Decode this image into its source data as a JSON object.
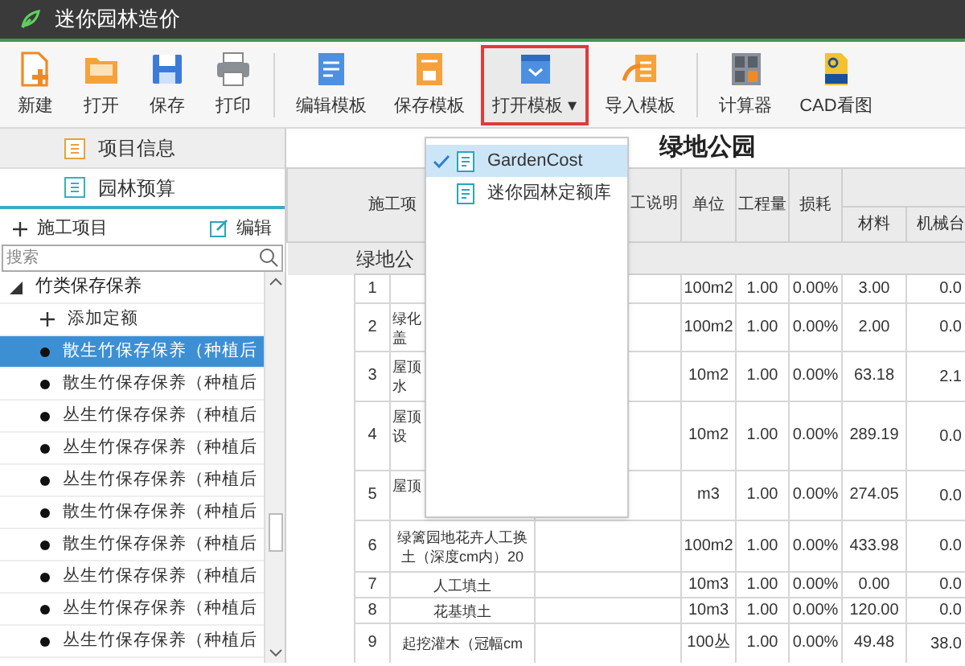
{
  "window": {
    "title": "迷你园林造价"
  },
  "toolbar": [
    {
      "kind": "new",
      "label": "新建",
      "highlighted": false,
      "divider_after": false
    },
    {
      "kind": "open",
      "label": "打开",
      "highlighted": false,
      "divider_after": false
    },
    {
      "kind": "save",
      "label": "保存",
      "highlighted": false,
      "divider_after": false
    },
    {
      "kind": "print",
      "label": "打印",
      "highlighted": false,
      "divider_after": true
    },
    {
      "kind": "edit-template",
      "label": "编辑模板",
      "highlighted": false,
      "divider_after": false
    },
    {
      "kind": "save-template",
      "label": "保存模板",
      "highlighted": false,
      "divider_after": false
    },
    {
      "kind": "open-template",
      "label": "打开模板",
      "caret": "▾",
      "highlighted": true,
      "divider_after": false
    },
    {
      "kind": "import-template",
      "label": "导入模板",
      "highlighted": false,
      "divider_after": true
    },
    {
      "kind": "calculator",
      "label": "计算器",
      "highlighted": false,
      "divider_after": false
    },
    {
      "kind": "cad",
      "label": "CAD看图",
      "highlighted": false,
      "divider_after": false
    }
  ],
  "sidebar": {
    "tabs": [
      {
        "kind": "info",
        "label": "项目信息",
        "selected": false
      },
      {
        "kind": "budget",
        "label": "园林预算",
        "selected": true
      }
    ],
    "add_label": "施工项目",
    "edit_label": "编辑",
    "search": {
      "placeholder": "搜索"
    },
    "tree": [
      {
        "label": "竹类保存保养",
        "expanded": true,
        "children": [
          {
            "kind": "add",
            "label": "添加定额",
            "selected": false
          },
          {
            "kind": "item",
            "label": "散生竹保存保养（种植后",
            "selected": true
          },
          {
            "kind": "item",
            "label": "散生竹保存保养（种植后",
            "selected": false
          },
          {
            "kind": "item",
            "label": "丛生竹保存保养（种植后",
            "selected": false
          },
          {
            "kind": "item",
            "label": "丛生竹保存保养（种植后",
            "selected": false
          },
          {
            "kind": "item",
            "label": "丛生竹保存保养（种植后",
            "selected": false
          },
          {
            "kind": "item",
            "label": "散生竹保存保养（种植后",
            "selected": false
          },
          {
            "kind": "item",
            "label": "散生竹保存保养（种植后",
            "selected": false
          },
          {
            "kind": "item",
            "label": "丛生竹保存保养（种植后",
            "selected": false
          },
          {
            "kind": "item",
            "label": "丛生竹保存保养（种植后",
            "selected": false
          },
          {
            "kind": "item",
            "label": "丛生竹保存保养（种植后",
            "selected": false
          }
        ]
      }
    ]
  },
  "sheet": {
    "title": "绿地公园",
    "columns": {
      "name": "施工项",
      "description": "工说明",
      "unit": "单位",
      "quantity": "工程量",
      "loss": "损耗",
      "material": "材料",
      "machine": "机械台"
    },
    "section": "绿地公",
    "rows": [
      {
        "no": "1",
        "name": "",
        "unit": "100m2",
        "quantity": "1.00",
        "loss": "0.00%",
        "material": "3.00",
        "machine": "0.0"
      },
      {
        "no": "2",
        "name": "绿化盖",
        "unit": "100m2",
        "quantity": "1.00",
        "loss": "0.00%",
        "material": "2.00",
        "machine": "0.0"
      },
      {
        "no": "3",
        "name": "屋顶水",
        "unit": "10m2",
        "quantity": "1.00",
        "loss": "0.00%",
        "material": "63.18",
        "machine": "2.1"
      },
      {
        "no": "4",
        "name": "屋顶设",
        "unit": "10m2",
        "quantity": "1.00",
        "loss": "0.00%",
        "material": "289.19",
        "machine": "0.0"
      },
      {
        "no": "5",
        "name": "屋顶",
        "unit": "m3",
        "quantity": "1.00",
        "loss": "0.00%",
        "material": "274.05",
        "machine": "0.0"
      },
      {
        "no": "6",
        "name": "绿篱园地花卉人工换土（深度cm内）20",
        "unit": "100m2",
        "quantity": "1.00",
        "loss": "0.00%",
        "material": "433.98",
        "machine": "0.0"
      },
      {
        "no": "7",
        "name": "人工填土",
        "unit": "10m3",
        "quantity": "1.00",
        "loss": "0.00%",
        "material": "0.00",
        "machine": "0.0"
      },
      {
        "no": "8",
        "name": "花基填土",
        "unit": "10m3",
        "quantity": "1.00",
        "loss": "0.00%",
        "material": "120.00",
        "machine": "0.0"
      },
      {
        "no": "9",
        "name": "起挖灌木（冠幅cm",
        "unit": "100丛",
        "quantity": "1.00",
        "loss": "0.00%",
        "material": "49.48",
        "machine": "38.0"
      }
    ]
  },
  "template_menu": [
    {
      "label": "GardenCost",
      "selected": true
    },
    {
      "label": "迷你园林定额库",
      "selected": false
    }
  ]
}
